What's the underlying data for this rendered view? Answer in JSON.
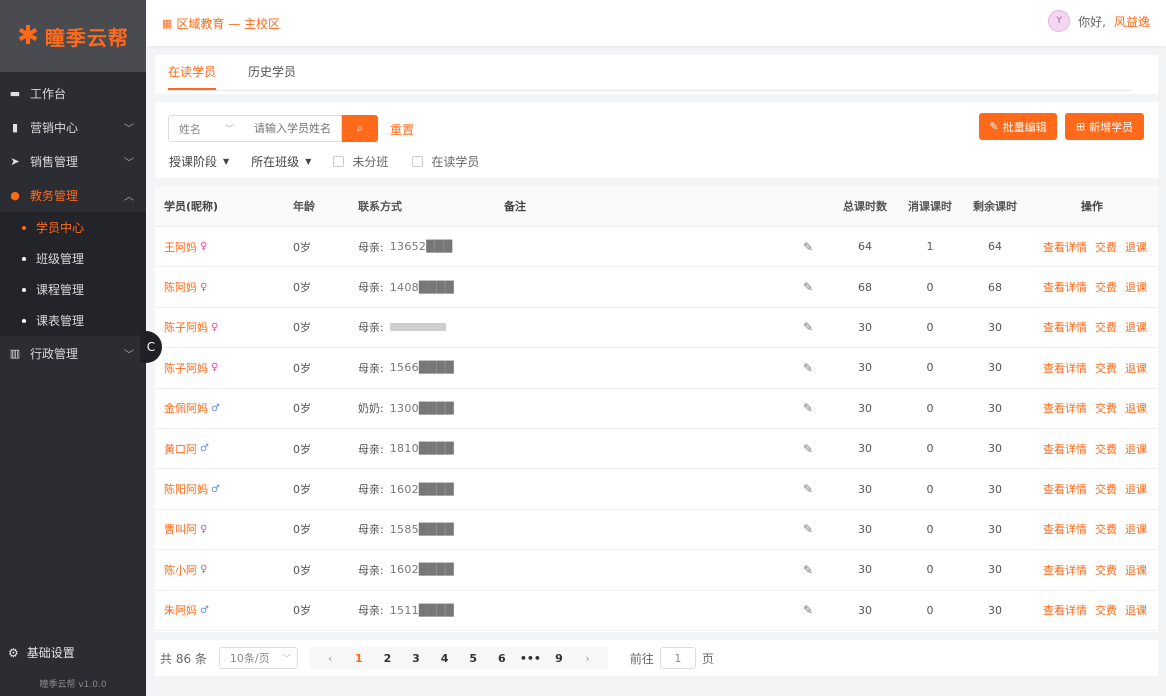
{
  "app": {
    "logo_mark": "✱",
    "logo_text": "瞳季云帮"
  },
  "sidebar": {
    "items": [
      {
        "label": "工作台",
        "icon": "monitor-icon"
      },
      {
        "label": "营销中心",
        "icon": "book-icon"
      },
      {
        "label": "销售管理",
        "icon": "send-icon"
      },
      {
        "label": "教务管理",
        "icon": "location-pin-icon"
      },
      {
        "label": "行政管理",
        "icon": "bar-chart-icon"
      }
    ],
    "submenu": [
      "学员中心",
      "班级管理",
      "课程管理",
      "课表管理"
    ],
    "collapse_label": "C",
    "settings_label": "基础设置",
    "version": "瞳季云帮 v1.0.0"
  },
  "header": {
    "breadcrumb": "区域教育 — 主校区",
    "greeting": "你好,",
    "username": "风益逸"
  },
  "tabs": [
    "在读学员",
    "历史学员"
  ],
  "filter": {
    "select_value": "姓名",
    "search_placeholder": "请输入学员姓名",
    "search_icon": "search-icon",
    "reset_label": "重置",
    "batch_button": "批量编辑",
    "add_button": "新增学员",
    "dropdown_1": "授课阶段",
    "dropdown_2": "所在班级",
    "checkbox_1": "未分班",
    "checkbox_2": "在读学员"
  },
  "table": {
    "headers": {
      "name": "学员(昵称)",
      "age": "年龄",
      "contact": "联系方式",
      "note": "备注",
      "total": "总课时数",
      "used": "消课课时",
      "left": "剩余课时",
      "ops": "操作"
    },
    "ops_labels": [
      "查看详情",
      "交费",
      "退课"
    ],
    "rows": [
      {
        "name": "王阿妈",
        "gender": "female",
        "age": "0岁",
        "contact_label": "母亲:",
        "phone": "13652███",
        "total": "64",
        "used": "1",
        "left": "64"
      },
      {
        "name": "陈阿妈",
        "gender": "female",
        "age": "0岁",
        "contact_label": "母亲:",
        "phone": "1408████",
        "total": "68",
        "used": "0",
        "left": "68"
      },
      {
        "name": "陈子阿妈",
        "gender": "female",
        "age": "0岁",
        "contact_label": "母亲:",
        "phone": "",
        "total": "30",
        "used": "0",
        "left": "30"
      },
      {
        "name": "陈子阿妈",
        "gender": "female",
        "age": "0岁",
        "contact_label": "母亲:",
        "phone": "1566████",
        "total": "30",
        "used": "0",
        "left": "30"
      },
      {
        "name": "金佩阿妈",
        "gender": "male",
        "age": "0岁",
        "contact_label": "奶奶:",
        "phone": "1300████",
        "total": "30",
        "used": "0",
        "left": "30"
      },
      {
        "name": "黄口阿",
        "gender": "male",
        "age": "0岁",
        "contact_label": "母亲:",
        "phone": "1810████",
        "total": "30",
        "used": "0",
        "left": "30"
      },
      {
        "name": "陈阳阿妈",
        "gender": "male",
        "age": "0岁",
        "contact_label": "母亲:",
        "phone": "1602████",
        "total": "30",
        "used": "0",
        "left": "30"
      },
      {
        "name": "曹叫阿",
        "gender": "female",
        "age": "0岁",
        "contact_label": "母亲:",
        "phone": "1585████",
        "total": "30",
        "used": "0",
        "left": "30"
      },
      {
        "name": "陈小阿",
        "gender": "female",
        "age": "0岁",
        "contact_label": "母亲:",
        "phone": "1602████",
        "total": "30",
        "used": "0",
        "left": "30"
      },
      {
        "name": "朱阿妈",
        "gender": "male",
        "age": "0岁",
        "contact_label": "母亲:",
        "phone": "1511████",
        "total": "30",
        "used": "0",
        "left": "30"
      }
    ]
  },
  "pagination": {
    "total_text": "共 86 条",
    "page_size": "10条/页",
    "pages": [
      "1",
      "2",
      "3",
      "4",
      "5",
      "6",
      "•••",
      "9"
    ],
    "current_page": "1",
    "prev": "‹",
    "next": "›",
    "goto_label": "前往",
    "goto_value": "1",
    "goto_suffix": "页"
  },
  "colors": {
    "accent": "#ff6a1a",
    "sidebar_bg": "#2b2d33",
    "logo_bg": "#4a4b50"
  }
}
